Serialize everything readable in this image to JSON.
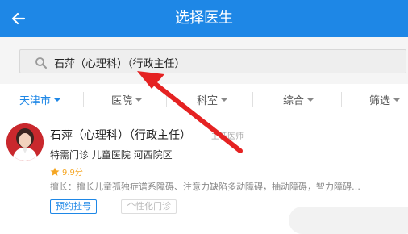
{
  "header": {
    "title": "选择医生",
    "back_icon": "arrow-left-icon",
    "background": "#1e87e6"
  },
  "search": {
    "value": "石萍（心理科）（行政主任）",
    "icon": "search-icon"
  },
  "filters": [
    {
      "label": "天津市",
      "active": true
    },
    {
      "label": "医院",
      "active": false
    },
    {
      "label": "科室",
      "active": false
    },
    {
      "label": "综合",
      "active": false
    },
    {
      "label": "筛选",
      "active": false
    }
  ],
  "doctor": {
    "name": "石萍（心理科）（行政主任）",
    "title": "主任医师",
    "clinic": "特需门诊  儿童医院 河西院区",
    "rating": "9.9分",
    "specialty": "擅长：擅长儿童孤独症谱系障碍、注意力缺陷多动障碍，抽动障碍，智力障碍…",
    "book_button": "预约挂号",
    "custom_button": "个性化门诊"
  },
  "annotation": {
    "arrow_color": "#e52222"
  },
  "colors": {
    "accent": "#1e87e6",
    "star": "#f5a623"
  }
}
